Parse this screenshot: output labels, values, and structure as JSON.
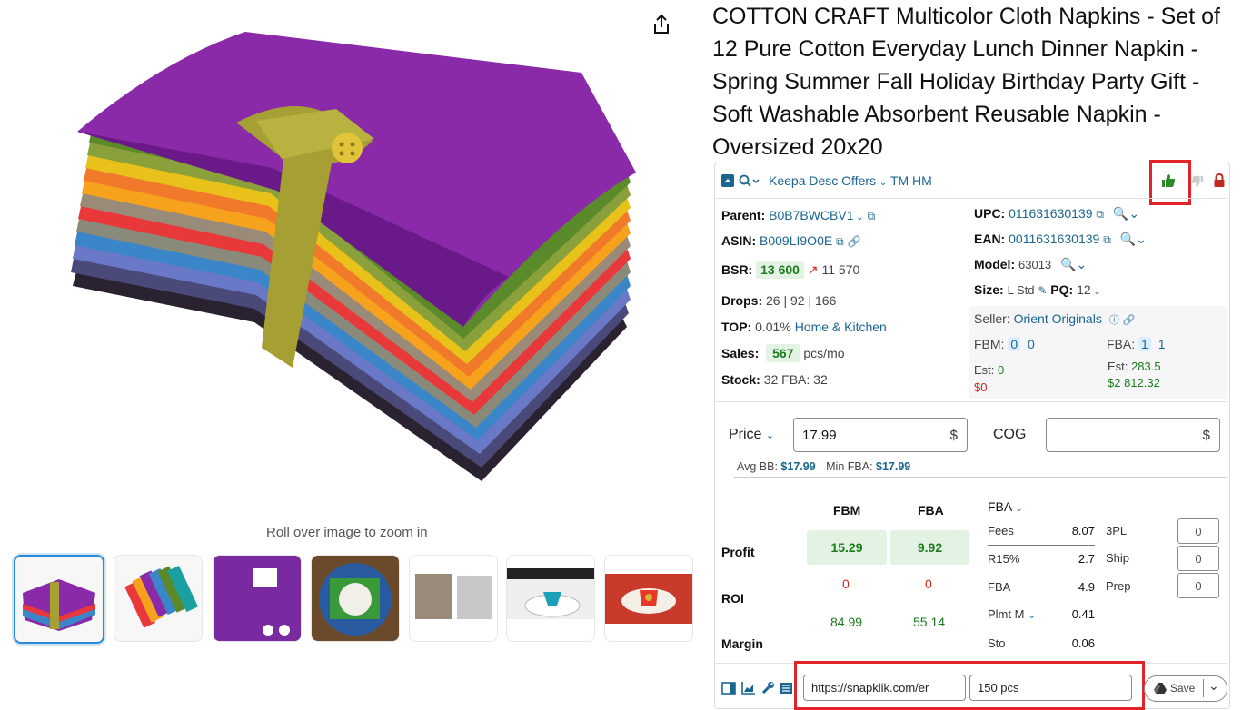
{
  "product": {
    "title": "COTTON CRAFT Multicolor Cloth Napkins - Set of 12 Pure Cotton Everyday Lunch Dinner Napkin - Spring Summer Fall Holiday Birthday Party Gift - Soft Washable Absorbent Reusable Napkin - Oversized 20x20",
    "zoom_hint": "Roll over image to zoom in"
  },
  "keepa": {
    "toolbar_label": "Keepa Desc Offers",
    "toolbar_extra": "TM HM",
    "parent_label": "Parent:",
    "parent_value": "B0B7BWCBV1",
    "asin_label": "ASIN:",
    "asin_value": "B009LI9O0E",
    "bsr_label": "BSR:",
    "bsr_value": "13 600",
    "bsr_trend": "11 570",
    "drops_label": "Drops:",
    "drops_value": "26 | 92 | 166",
    "top_label": "TOP:",
    "top_value": "0.01%",
    "top_category": "Home & Kitchen",
    "sales_label": "Sales:",
    "sales_value": "567",
    "sales_unit": "pcs/mo",
    "stock_label": "Stock:",
    "stock_value": "32 FBA: 32",
    "upc_label": "UPC:",
    "upc_value": "011631630139",
    "ean_label": "EAN:",
    "ean_value": "0011631630139",
    "model_label": "Model:",
    "model_value": "63013",
    "size_label": "Size:",
    "size_value": "L Std",
    "pq_label": "PQ:",
    "pq_value": "12",
    "seller_label": "Seller:",
    "seller_value": "Orient Originals",
    "fbm_label": "FBM:",
    "fbm_count": "0",
    "fbm_count2": "0",
    "fbm_est_label": "Est:",
    "fbm_est_value": "0",
    "fbm_est_money": "$0",
    "fba_label": "FBA:",
    "fba_count": "1",
    "fba_count2": "1",
    "fba_est_label": "Est:",
    "fba_est_value": "283.5",
    "fba_est_money": "$2 812.32"
  },
  "pricing": {
    "price_label": "Price",
    "price_value": "17.99",
    "currency": "$",
    "cog_label": "COG",
    "cog_value": "",
    "avg_bb_label": "Avg BB:",
    "avg_bb_value": "$17.99",
    "min_fba_label": "Min FBA:",
    "min_fba_value": "$17.99"
  },
  "profit": {
    "col_fbm": "FBM",
    "col_fba": "FBA",
    "profit_label": "Profit",
    "profit_fbm": "15.29",
    "profit_fba": "9.92",
    "roi_label": "ROI",
    "roi_fbm": "0",
    "roi_fba": "0",
    "margin_label": "Margin",
    "margin_fbm": "84.99",
    "margin_fba": "55.14",
    "fees_mode": "FBA",
    "fees": [
      {
        "label": "Fees",
        "value": "8.07"
      },
      {
        "label": "R15%",
        "value": "2.7"
      },
      {
        "label": "FBA",
        "value": "4.9"
      },
      {
        "label": "Plmt M",
        "value": "0.41"
      },
      {
        "label": "Sto",
        "value": "0.06"
      }
    ],
    "extras": [
      {
        "label": "3PL",
        "value": "0"
      },
      {
        "label": "Ship",
        "value": "0"
      },
      {
        "label": "Prep",
        "value": "0"
      }
    ]
  },
  "footer": {
    "url_value": "https://snapklik.com/er",
    "qty_value": "150 pcs",
    "save_label": "Save"
  },
  "colors": {
    "accent_blue": "#1a6690",
    "green": "#1d7a1d",
    "red": "#d0271d",
    "highlight_red": "#e0242a"
  }
}
